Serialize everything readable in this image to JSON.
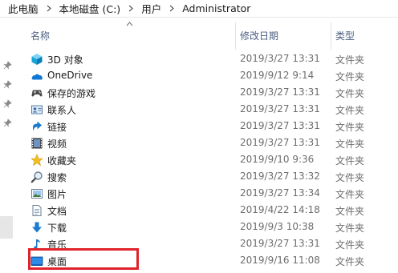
{
  "breadcrumb": [
    "此电脑",
    "本地磁盘 (C:)",
    "用户",
    "Administrator"
  ],
  "columns": {
    "name": "名称",
    "date": "修改日期",
    "type": "类型"
  },
  "rows": [
    {
      "name": "3D 对象",
      "date": "2019/3/27 13:31",
      "type": "文件夹",
      "icon": "3d-objects-icon"
    },
    {
      "name": "OneDrive",
      "date": "2019/9/12 9:14",
      "type": "文件夹",
      "icon": "onedrive-icon"
    },
    {
      "name": "保存的游戏",
      "date": "2019/3/27 13:31",
      "type": "文件夹",
      "icon": "saved-games-icon"
    },
    {
      "name": "联系人",
      "date": "2019/3/27 13:31",
      "type": "文件夹",
      "icon": "contacts-icon"
    },
    {
      "name": "链接",
      "date": "2019/3/27 13:31",
      "type": "文件夹",
      "icon": "links-icon"
    },
    {
      "name": "视频",
      "date": "2019/3/27 13:31",
      "type": "文件夹",
      "icon": "videos-icon"
    },
    {
      "name": "收藏夹",
      "date": "2019/9/10 9:36",
      "type": "文件夹",
      "icon": "favorites-icon"
    },
    {
      "name": "搜索",
      "date": "2019/3/27 13:32",
      "type": "文件夹",
      "icon": "searches-icon"
    },
    {
      "name": "图片",
      "date": "2019/3/27 13:34",
      "type": "文件夹",
      "icon": "pictures-icon"
    },
    {
      "name": "文档",
      "date": "2019/4/22 14:18",
      "type": "文件夹",
      "icon": "documents-icon"
    },
    {
      "name": "下载",
      "date": "2019/9/3 10:38",
      "type": "文件夹",
      "icon": "downloads-icon"
    },
    {
      "name": "音乐",
      "date": "2019/3/27 13:31",
      "type": "文件夹",
      "icon": "music-icon"
    },
    {
      "name": "桌面",
      "date": "2019/9/16 11:08",
      "type": "文件夹",
      "icon": "desktop-icon"
    }
  ],
  "colors": {
    "highlight": "#e0232b",
    "header_text": "#4d6082"
  }
}
